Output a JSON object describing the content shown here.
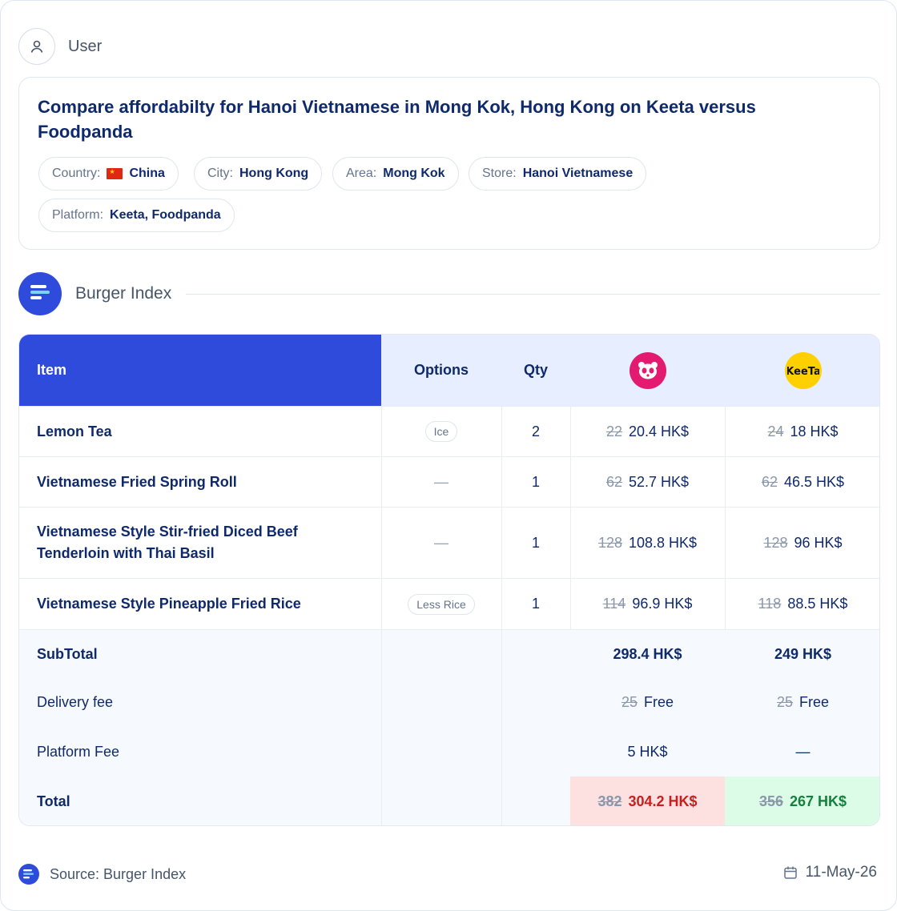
{
  "user": {
    "label": "User"
  },
  "query": {
    "title": "Compare affordabilty for Hanoi Vietnamese in Mong Kok, Hong Kong on Keeta versus Foodpanda",
    "chips": [
      {
        "key": "Country:",
        "value": "China"
      },
      {
        "key": "City:",
        "value": "Hong Kong"
      },
      {
        "key": "Area:",
        "value": "Mong Kok"
      },
      {
        "key": "Store:",
        "value": "Hanoi Vietnamese"
      },
      {
        "key": "Platform:",
        "value": "Keeta, Foodpanda"
      }
    ]
  },
  "section": {
    "title": "Burger Index"
  },
  "table": {
    "headers": {
      "item": "Item",
      "options": "Options",
      "qty": "Qty"
    },
    "rows": [
      {
        "item": "Lemon Tea",
        "option": "Ice",
        "qty": "2",
        "fp_old": "22",
        "fp_new": "20.4 HK$",
        "kt_old": "24",
        "kt_new": "18 HK$"
      },
      {
        "item": "Vietnamese Fried Spring Roll",
        "option": "—",
        "qty": "1",
        "fp_old": "62",
        "fp_new": "52.7 HK$",
        "kt_old": "62",
        "kt_new": "46.5 HK$"
      },
      {
        "item": "Vietnamese Style Stir-fried Diced Beef Tenderloin with Thai Basil",
        "option": "—",
        "qty": "1",
        "fp_old": "128",
        "fp_new": "108.8 HK$",
        "kt_old": "128",
        "kt_new": "96 HK$"
      },
      {
        "item": "Vietnamese Style Pineapple Fried Rice",
        "option": "Less Rice",
        "qty": "1",
        "fp_old": "114",
        "fp_new": "96.9 HK$",
        "kt_old": "118",
        "kt_new": "88.5 HK$"
      }
    ],
    "subtotal": {
      "label": "SubTotal",
      "fp": "298.4 HK$",
      "kt": "249 HK$"
    },
    "delivery": {
      "label": "Delivery fee",
      "fp_old": "25",
      "fp_new": "Free",
      "kt_old": "25",
      "kt_new": "Free"
    },
    "platform_fee": {
      "label": "Platform Fee",
      "fp": "5 HK$",
      "kt": "—"
    },
    "total": {
      "label": "Total",
      "fp_old": "382",
      "fp_new": "304.2 HK$",
      "kt_old": "356",
      "kt_new": "267 HK$"
    }
  },
  "footer": {
    "source": "Source: Burger Index",
    "date": "11-May-26"
  },
  "colors": {
    "brand": "#2f4bdc",
    "foodpanda": "#e21b70",
    "keeta": "#ffd000",
    "total_red": "#c81e1e",
    "total_green": "#15803d"
  },
  "icons": {
    "user": "user-icon",
    "brand": "burger-index-logo",
    "foodpanda": "foodpanda-logo",
    "keeta": "keeta-logo",
    "calendar": "calendar-icon"
  }
}
